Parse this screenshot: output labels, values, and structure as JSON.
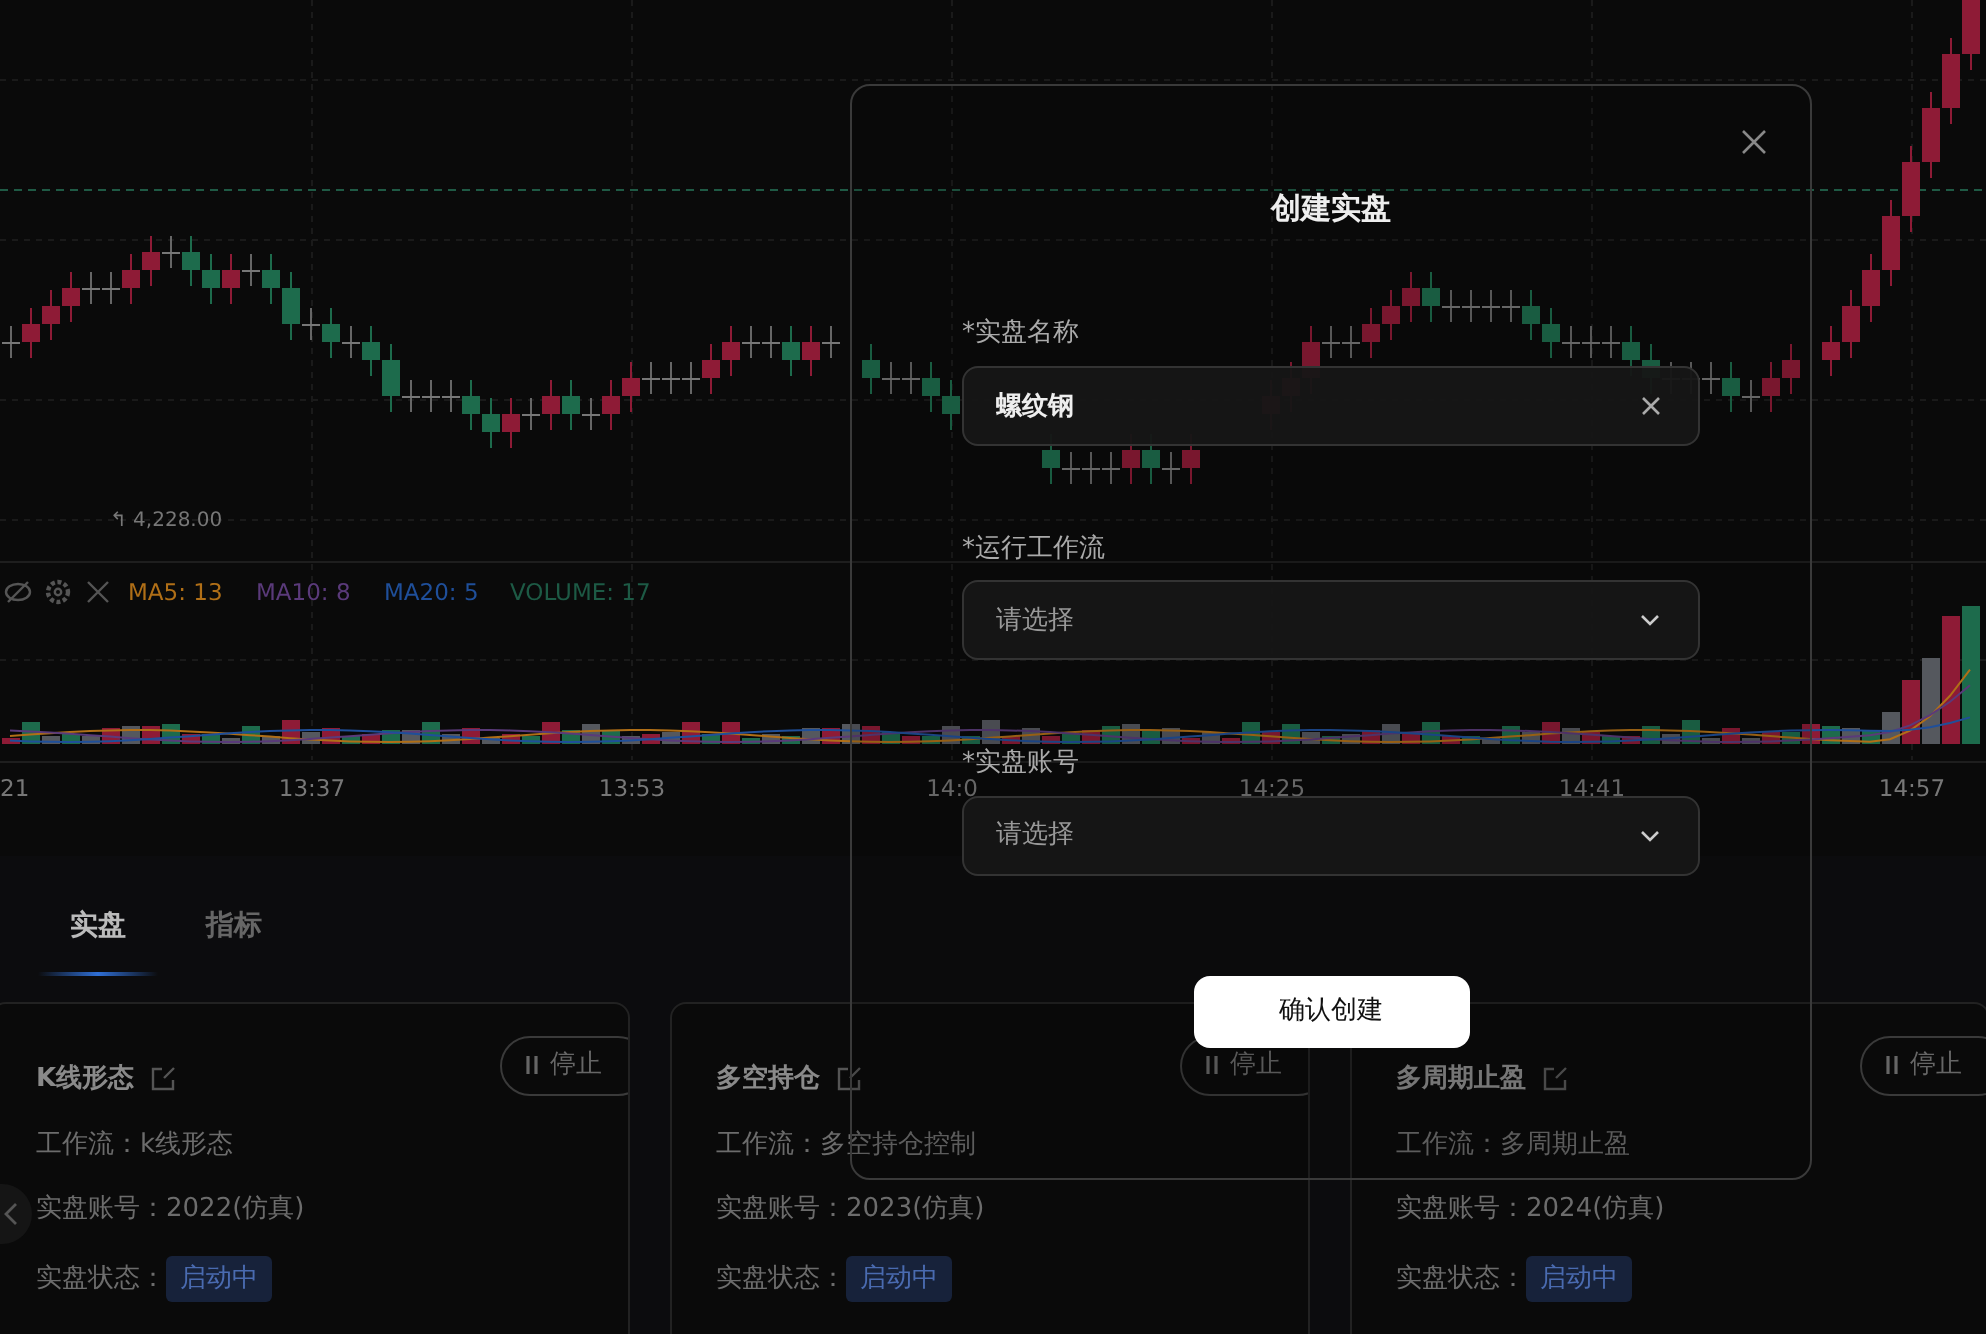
{
  "chart": {
    "low_marker": "↰ 4,228.00",
    "legend": [
      {
        "label": "MA5: 13",
        "color": "#b06f17"
      },
      {
        "label": "MA10: 8",
        "color": "#5a3a7a"
      },
      {
        "label": "MA20: 5",
        "color": "#1f4f9a"
      },
      {
        "label": "VOLUME: 17",
        "color": "#1d5a45"
      }
    ],
    "time_labels": [
      "21",
      "13:37",
      "13:53",
      "14:0",
      "14:25",
      "14:41",
      "14:57"
    ]
  },
  "tabs": [
    {
      "label": "实盘",
      "selected": true
    },
    {
      "label": "指标",
      "selected": false
    }
  ],
  "cards": [
    {
      "title": "K线形态",
      "stop_button": "停止",
      "workflow": "工作流：k线形态",
      "account": "实盘账号：2022(仿真)",
      "status_label": "实盘状态：",
      "status": "启动中"
    },
    {
      "title": "多空持仓",
      "stop_button": "停止",
      "workflow": "工作流：多空持仓控制",
      "account": "实盘账号：2023(仿真)",
      "status_label": "实盘状态：",
      "status": "启动中"
    },
    {
      "title": "多周期止盈",
      "stop_button": "停止",
      "workflow": "工作流：多周期止盈",
      "account": "实盘账号：2024(仿真)",
      "status_label": "实盘状态：",
      "status": "启动中"
    }
  ],
  "modal": {
    "title": "创建实盘",
    "submit": "确认创建",
    "fields": [
      {
        "kind": "text",
        "label": "*实盘名称",
        "value": "螺纹钢"
      },
      {
        "kind": "select",
        "label": "*运行工作流",
        "placeholder": "请选择"
      },
      {
        "kind": "select",
        "label": "*实盘账号",
        "placeholder": "请选择"
      }
    ]
  }
}
